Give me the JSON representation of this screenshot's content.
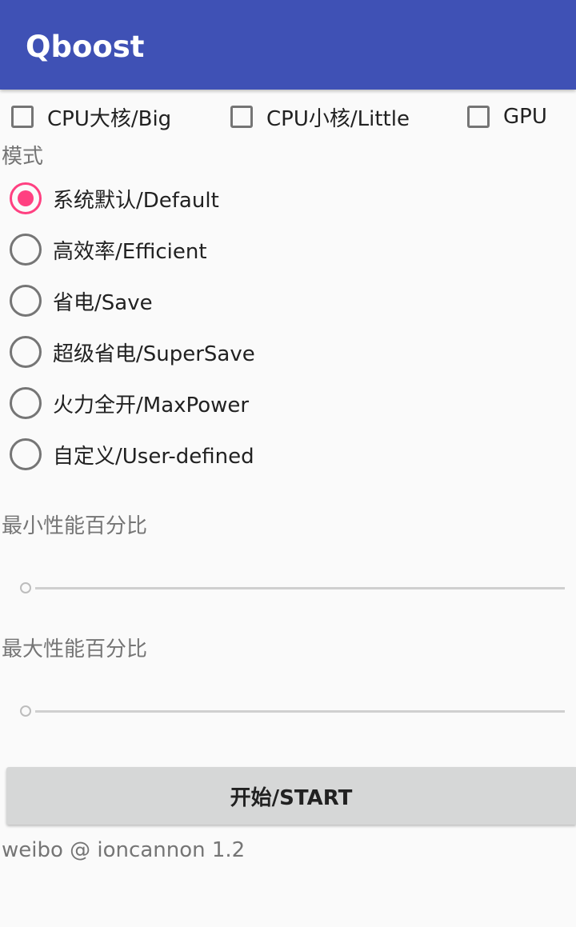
{
  "app_bar": {
    "title": "Qboost",
    "color": "#3f51b5"
  },
  "options": {
    "big_core": {
      "label": "CPU大核/Big",
      "checked": false
    },
    "little_core": {
      "label": "CPU小核/Little",
      "checked": false
    },
    "gpu": {
      "label": "GPU",
      "checked": false
    }
  },
  "mode": {
    "label": "模式",
    "selected": "default",
    "items": [
      {
        "id": "default",
        "label": "系统默认/Default",
        "checked": true
      },
      {
        "id": "efficient",
        "label": "高效率/Efficient",
        "checked": false
      },
      {
        "id": "save",
        "label": "省电/Save",
        "checked": false
      },
      {
        "id": "supersave",
        "label": "超级省电/SuperSave",
        "checked": false
      },
      {
        "id": "maxpower",
        "label": "火力全开/MaxPower",
        "checked": false
      },
      {
        "id": "userdefined",
        "label": "自定义/User-defined",
        "checked": false
      }
    ],
    "accent_color": "#ff4081"
  },
  "min_perf": {
    "label": "最小性能百分比",
    "value_fraction": 0
  },
  "max_perf": {
    "label": "最大性能百分比",
    "value_fraction": 0
  },
  "start_button": {
    "label": "开始/START"
  },
  "footer": {
    "text": "weibo @ ioncannon 1.2"
  }
}
